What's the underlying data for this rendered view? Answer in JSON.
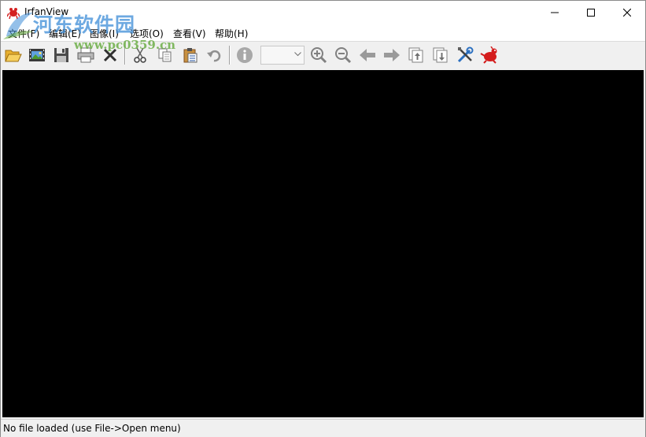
{
  "window": {
    "title": "IrfanView"
  },
  "menu": [
    {
      "label": "文件(F)"
    },
    {
      "label": "编辑(E)"
    },
    {
      "label": "图像(I)"
    },
    {
      "label": "选项(O)"
    },
    {
      "label": "查看(V)"
    },
    {
      "label": "帮助(H)"
    }
  ],
  "toolbar": {
    "zoom_value": "",
    "icons": [
      "open-folder-icon",
      "slideshow-icon",
      "save-icon",
      "print-icon",
      "delete-icon",
      "cut-icon",
      "copy-icon",
      "paste-icon",
      "undo-icon",
      "info-icon",
      "zoom-in-icon",
      "zoom-out-icon",
      "previous-icon",
      "next-icon",
      "first-file-icon",
      "last-file-icon",
      "settings-icon",
      "about-icon"
    ]
  },
  "status": {
    "text": "No file loaded (use File->Open menu)"
  },
  "watermark": {
    "name": "河东软件园",
    "url": "www.pc0359.cn"
  },
  "colors": {
    "viewer_bg": "#000000",
    "chrome_bg": "#f0f0f0",
    "watermark_blue": "#3c8cd7",
    "watermark_green": "#64aa3c"
  }
}
